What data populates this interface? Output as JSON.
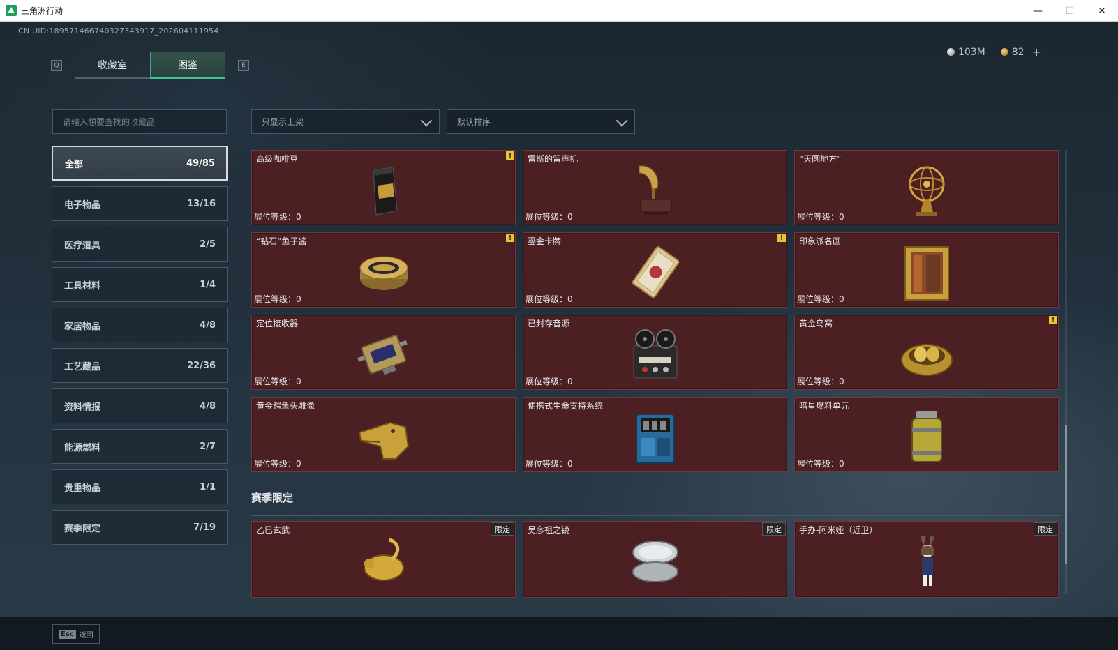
{
  "window": {
    "title": "三角洲行动",
    "minimize": "—",
    "maximize": "☐",
    "close": "✕"
  },
  "uid": "CN UID:18957146674032734391​7_202604111954",
  "currency": {
    "silver": "103M",
    "gold": "82",
    "plus": "+"
  },
  "keys": {
    "prev": "Q",
    "next": "E"
  },
  "tabs": [
    {
      "label": "收藏室"
    },
    {
      "label": "图鉴"
    }
  ],
  "search": {
    "placeholder": "请输入想要查找的收藏品"
  },
  "filters": {
    "show": "只显示上架",
    "sort": "默认排序"
  },
  "categories": [
    {
      "label": "全部",
      "count": "49/85"
    },
    {
      "label": "电子物品",
      "count": "13/16"
    },
    {
      "label": "医疗道具",
      "count": "2/5"
    },
    {
      "label": "工具材料",
      "count": "1/4"
    },
    {
      "label": "家居物品",
      "count": "4/8"
    },
    {
      "label": "工艺藏品",
      "count": "22/36"
    },
    {
      "label": "资料情报",
      "count": "4/8"
    },
    {
      "label": "能源燃料",
      "count": "2/7"
    },
    {
      "label": "贵重物品",
      "count": "1/1"
    },
    {
      "label": "赛季限定",
      "count": "7/19"
    }
  ],
  "level_label": "展位等级：0",
  "warn_glyph": "!",
  "items": [
    {
      "name": "高级咖啡豆",
      "icon": "coffee-bag-icon",
      "warn": true
    },
    {
      "name": "雷斯的留声机",
      "icon": "gramophone-icon",
      "warn": false
    },
    {
      "name": "“天圆地方”",
      "icon": "armillary-sphere-icon",
      "warn": false
    },
    {
      "name": "“钻石”鱼子酱",
      "icon": "caviar-tin-icon",
      "warn": true
    },
    {
      "name": "鎏金卡牌",
      "icon": "gilded-card-icon",
      "warn": true
    },
    {
      "name": "印象派名画",
      "icon": "framed-painting-icon",
      "warn": false
    },
    {
      "name": "定位接收器",
      "icon": "gps-receiver-icon",
      "warn": false
    },
    {
      "name": "已封存音源",
      "icon": "reel-tape-recorder-icon",
      "warn": false
    },
    {
      "name": "黄金鸟窝",
      "icon": "golden-nest-icon",
      "warn": true
    },
    {
      "name": "黄金鳄鱼头雕像",
      "icon": "gold-crocodile-head-icon",
      "warn": false
    },
    {
      "name": "便携式生命支持系统",
      "icon": "life-support-system-icon",
      "warn": false
    },
    {
      "name": "暗星燃料单元",
      "icon": "fuel-cell-icon",
      "warn": false
    }
  ],
  "season_section": {
    "title": "赛季限定",
    "tag": "限定",
    "items": [
      {
        "name": "乙巳玄武",
        "icon": "gold-turtle-snake-icon"
      },
      {
        "name": "吴彦祖之镜",
        "icon": "compact-mirror-icon"
      },
      {
        "name": "手办-阿米娅（近卫）",
        "icon": "amiya-figure-icon"
      }
    ]
  },
  "footer": {
    "esc_key": "Esc",
    "esc_label": "返回"
  },
  "colors": {
    "card_bg": "#4c1f23",
    "accent": "#45c58e",
    "warn": "#e8c23a"
  }
}
